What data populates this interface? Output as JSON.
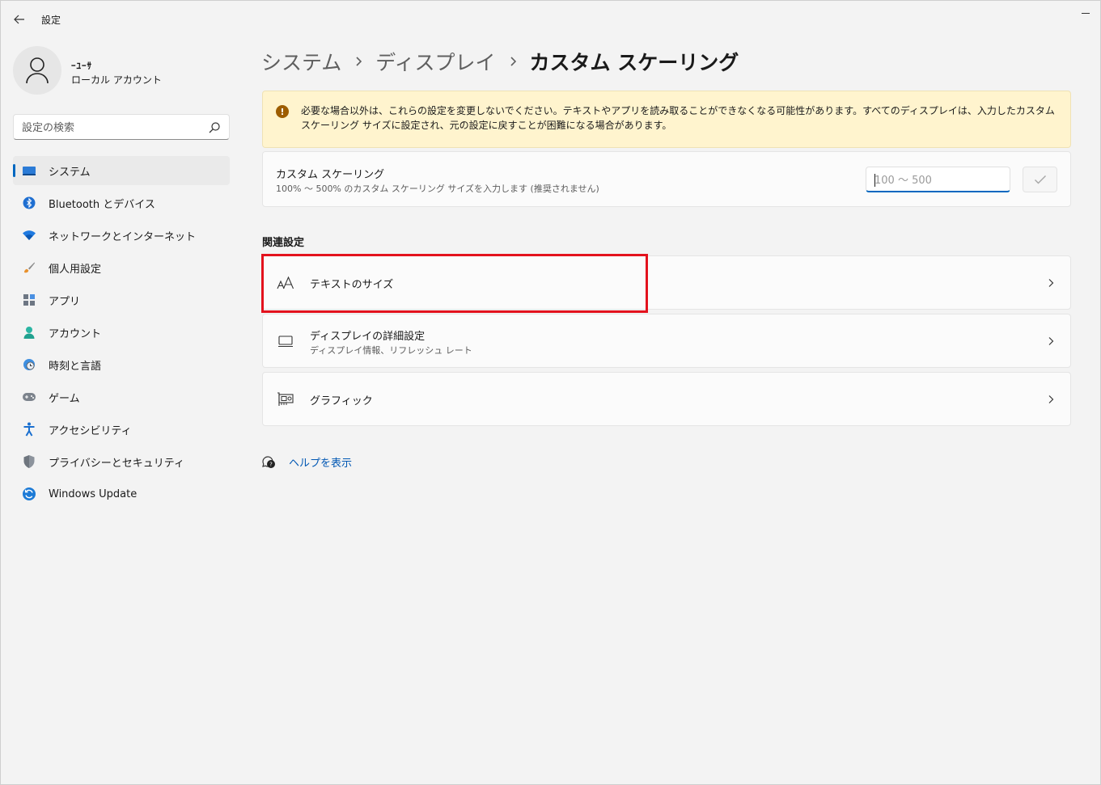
{
  "titlebar": {
    "app_title": "設定"
  },
  "account": {
    "name": "ｰﾕｰｻ",
    "type": "ローカル アカウント"
  },
  "search": {
    "placeholder": "設定の検索"
  },
  "sidebar": {
    "items": [
      {
        "label": "システム",
        "icon": "system-icon",
        "selected": true
      },
      {
        "label": "Bluetooth とデバイス",
        "icon": "bluetooth-icon"
      },
      {
        "label": "ネットワークとインターネット",
        "icon": "wifi-icon"
      },
      {
        "label": "個人用設定",
        "icon": "brush-icon"
      },
      {
        "label": "アプリ",
        "icon": "apps-icon"
      },
      {
        "label": "アカウント",
        "icon": "account-icon"
      },
      {
        "label": "時刻と言語",
        "icon": "clock-globe-icon"
      },
      {
        "label": "ゲーム",
        "icon": "gamepad-icon"
      },
      {
        "label": "アクセシビリティ",
        "icon": "accessibility-icon"
      },
      {
        "label": "プライバシーとセキュリティ",
        "icon": "shield-icon"
      },
      {
        "label": "Windows Update",
        "icon": "windows-update-icon"
      }
    ]
  },
  "breadcrumb": {
    "level1": "システム",
    "level2": "ディスプレイ",
    "current": "カスタム スケーリング"
  },
  "warning": {
    "text": "必要な場合以外は、これらの設定を変更しないでください。テキストやアプリを読み取ることができなくなる可能性があります。すべてのディスプレイは、入力したカスタム スケーリング サイズに設定され、元の設定に戻すことが困難になる場合があります。"
  },
  "custom_scaling": {
    "title": "カスタム スケーリング",
    "subtitle": "100% 〜 500% のカスタム スケーリング サイズを入力します (推奨されません)",
    "input_value": "",
    "input_placeholder": "100 〜 500"
  },
  "related": {
    "section_title": "関連設定",
    "items": [
      {
        "title": "テキストのサイズ",
        "subtitle": "",
        "icon": "text-size-icon"
      },
      {
        "title": "ディスプレイの詳細設定",
        "subtitle": "ディスプレイ情報、リフレッシュ レート",
        "icon": "monitor-icon"
      },
      {
        "title": "グラフィック",
        "subtitle": "",
        "icon": "graphics-card-icon"
      }
    ]
  },
  "help": {
    "label": "ヘルプを表示"
  },
  "colors": {
    "accent": "#0067c0",
    "warning_bg": "#fff4ce",
    "highlight": "#e3121d",
    "link": "#0057b3"
  }
}
